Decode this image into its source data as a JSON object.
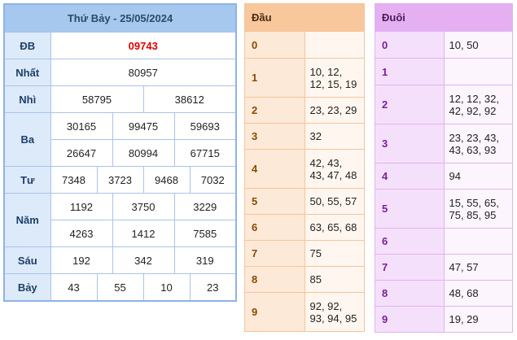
{
  "results": {
    "title": "Thứ Bảy - 25/05/2024",
    "rows": {
      "db": {
        "label": "ĐB",
        "values": [
          "09743"
        ]
      },
      "nhat": {
        "label": "Nhất",
        "values": [
          "80957"
        ]
      },
      "nhi": {
        "label": "Nhì",
        "values": [
          "58795",
          "38612"
        ]
      },
      "ba": {
        "label": "Ba",
        "values": [
          "30165",
          "99475",
          "59693",
          "26647",
          "80994",
          "67715"
        ]
      },
      "tu": {
        "label": "Tư",
        "values": [
          "7348",
          "3723",
          "9468",
          "7032"
        ]
      },
      "nam": {
        "label": "Năm",
        "values": [
          "1192",
          "3750",
          "3229",
          "4263",
          "1412",
          "7585"
        ]
      },
      "sau": {
        "label": "Sáu",
        "values": [
          "192",
          "342",
          "319"
        ]
      },
      "bay": {
        "label": "Bảy",
        "values": [
          "43",
          "55",
          "10",
          "23"
        ]
      }
    }
  },
  "dau": {
    "title": "Đầu",
    "rows": [
      {
        "key": "0",
        "values": ""
      },
      {
        "key": "1",
        "values": "10, 12, 12, 15, 19"
      },
      {
        "key": "2",
        "values": "23, 23, 29"
      },
      {
        "key": "3",
        "values": "32"
      },
      {
        "key": "4",
        "values": "42, 43, 43, 47, 48"
      },
      {
        "key": "5",
        "values": "50, 55, 57"
      },
      {
        "key": "6",
        "values": "63, 65, 68"
      },
      {
        "key": "7",
        "values": "75"
      },
      {
        "key": "8",
        "values": "85"
      },
      {
        "key": "9",
        "values": "92, 92, 93, 94, 95"
      }
    ]
  },
  "duoi": {
    "title": "Đuôi",
    "rows": [
      {
        "key": "0",
        "values": "10, 50"
      },
      {
        "key": "1",
        "values": ""
      },
      {
        "key": "2",
        "values": "12, 12, 32, 42, 92, 92"
      },
      {
        "key": "3",
        "values": "23, 23, 43, 43, 63, 93"
      },
      {
        "key": "4",
        "values": "94"
      },
      {
        "key": "5",
        "values": "15, 55, 65, 75, 85, 95"
      },
      {
        "key": "6",
        "values": ""
      },
      {
        "key": "7",
        "values": "47, 57"
      },
      {
        "key": "8",
        "values": "48, 68"
      },
      {
        "key": "9",
        "values": "19, 29"
      }
    ]
  }
}
